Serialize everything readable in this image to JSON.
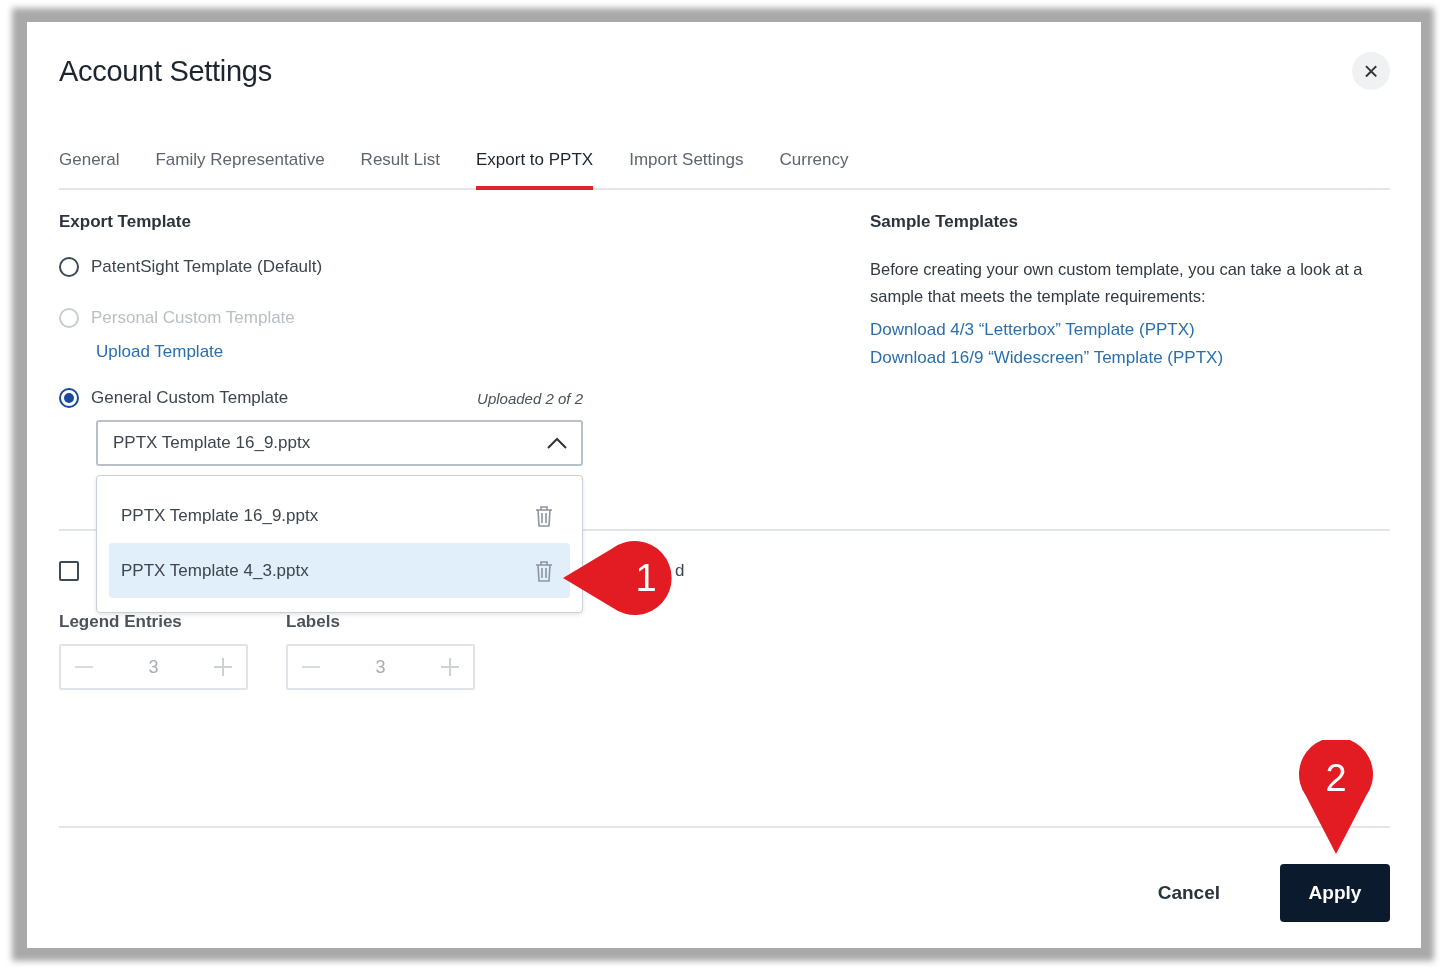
{
  "dialog": {
    "title": "Account Settings",
    "close": "×"
  },
  "tabs": [
    {
      "label": "General",
      "selected": false
    },
    {
      "label": "Family Representative",
      "selected": false
    },
    {
      "label": "Result List",
      "selected": false
    },
    {
      "label": "Export to PPTX",
      "selected": true
    },
    {
      "label": "Import Settings",
      "selected": false
    },
    {
      "label": "Currency",
      "selected": false
    }
  ],
  "export_template": {
    "heading": "Export Template",
    "options": [
      {
        "label": "PatentSight Template (Default)",
        "selected": false,
        "disabled": false
      },
      {
        "label": "Personal Custom Template",
        "selected": false,
        "disabled": true,
        "link": "Upload Template"
      },
      {
        "label": "General Custom Template",
        "selected": true,
        "disabled": false,
        "note": "Uploaded 2 of 2"
      }
    ],
    "select": {
      "value": "PPTX Template 16_9.pptx",
      "expanded": true,
      "options": [
        {
          "label": "PPTX Template 16_9.pptx",
          "highlighted": false
        },
        {
          "label": "PPTX Template 4_3.pptx",
          "highlighted": true
        }
      ]
    }
  },
  "checkbox": {
    "checked": false,
    "label_tail": "d"
  },
  "steppers": [
    {
      "label": "Legend Entries",
      "value": "3",
      "disabled": true
    },
    {
      "label": "Labels",
      "value": "3",
      "disabled": true
    }
  ],
  "sample_templates": {
    "heading": "Sample Templates",
    "text": "Before creating your own custom template, you can take a look at a sample that meets the template requirements:",
    "links": [
      "Download 4/3 “Letterbox” Template (PPTX)",
      "Download 16/9 “Widescreen” Template (PPTX)"
    ]
  },
  "buttons": [
    {
      "label": "Cancel",
      "kind": "secondary"
    },
    {
      "label": "Apply",
      "kind": "primary"
    }
  ],
  "annotations": [
    {
      "number": "1",
      "kind": "left"
    },
    {
      "number": "2",
      "kind": "down"
    }
  ]
}
